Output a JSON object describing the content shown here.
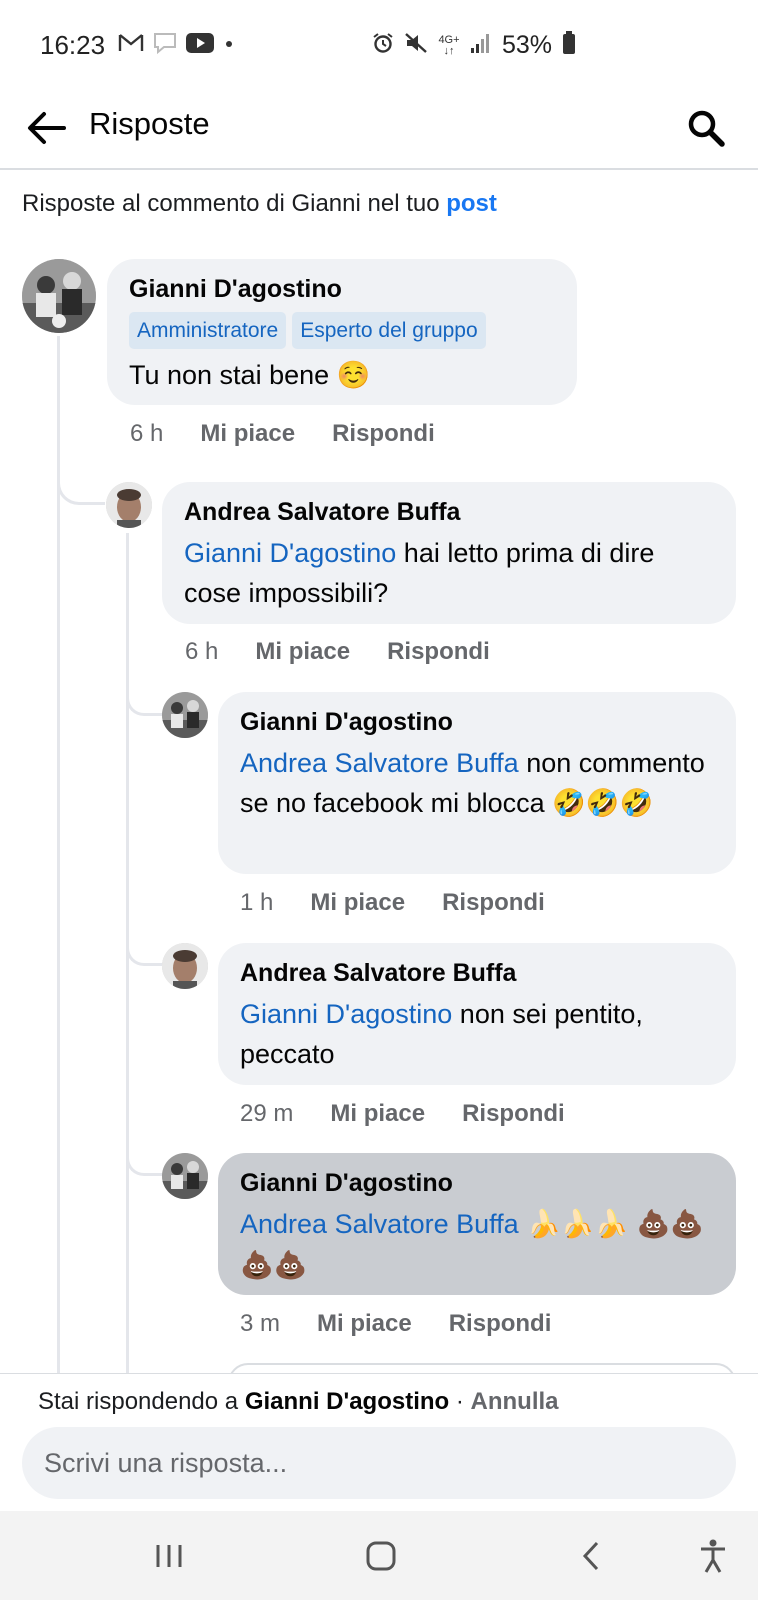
{
  "status_bar": {
    "time": "16:23",
    "battery_percent": "53%",
    "signal_label": "4G+",
    "icons_left": [
      "gmail-icon",
      "chat-icon",
      "youtube-icon",
      "dot-icon"
    ],
    "icons_right": [
      "alarm-icon",
      "mute-icon",
      "signal-icon",
      "battery-icon"
    ]
  },
  "app_bar": {
    "title": "Risposte"
  },
  "context": {
    "text": "Risposte al commento di Gianni nel tuo ",
    "link": "post"
  },
  "comments": [
    {
      "author": "Gianni D'agostino",
      "badges": [
        "Amministratore",
        "Esperto del gruppo"
      ],
      "mention": "",
      "text": "Tu non stai bene",
      "emoji": "☺️",
      "time": "6 h",
      "like_label": "Mi piace",
      "reply_label": "Rispondi"
    },
    {
      "author": "Andrea Salvatore Buffa",
      "mention": "Gianni D'agostino",
      "text": " hai letto prima di dire cose impossibili?",
      "time": "6 h",
      "like_label": "Mi piace",
      "reply_label": "Rispondi"
    },
    {
      "author": "Gianni D'agostino",
      "mention": "Andrea Salvatore Buffa",
      "text": " non commento se no facebook mi blocca",
      "emoji": "🤣🤣🤣",
      "time": "1 h",
      "like_label": "Mi piace",
      "reply_label": "Rispondi"
    },
    {
      "author": "Andrea Salvatore Buffa",
      "mention": "Gianni D'agostino",
      "text": " non sei pentito, peccato",
      "time": "29 m",
      "like_label": "Mi piace",
      "reply_label": "Rispondi"
    },
    {
      "author": "Gianni D'agostino",
      "mention": "Andrea Salvatore Buffa",
      "text": "",
      "emoji": "  🍌🍌🍌 💩💩💩💩",
      "time": "3 m",
      "like_label": "Mi piace",
      "reply_label": "Rispondi",
      "highlighted": true
    }
  ],
  "reply_bar": {
    "prefix": "Stai rispondendo a ",
    "target": "Gianni D'agostino",
    "separator": " · ",
    "cancel": "Annulla",
    "placeholder": "Scrivi una risposta..."
  },
  "colors": {
    "accent": "#1877f2",
    "mention": "#1565c0",
    "bubble": "#f0f2f5",
    "bubble_highlight": "#c9ccd1",
    "muted": "#65676b"
  }
}
